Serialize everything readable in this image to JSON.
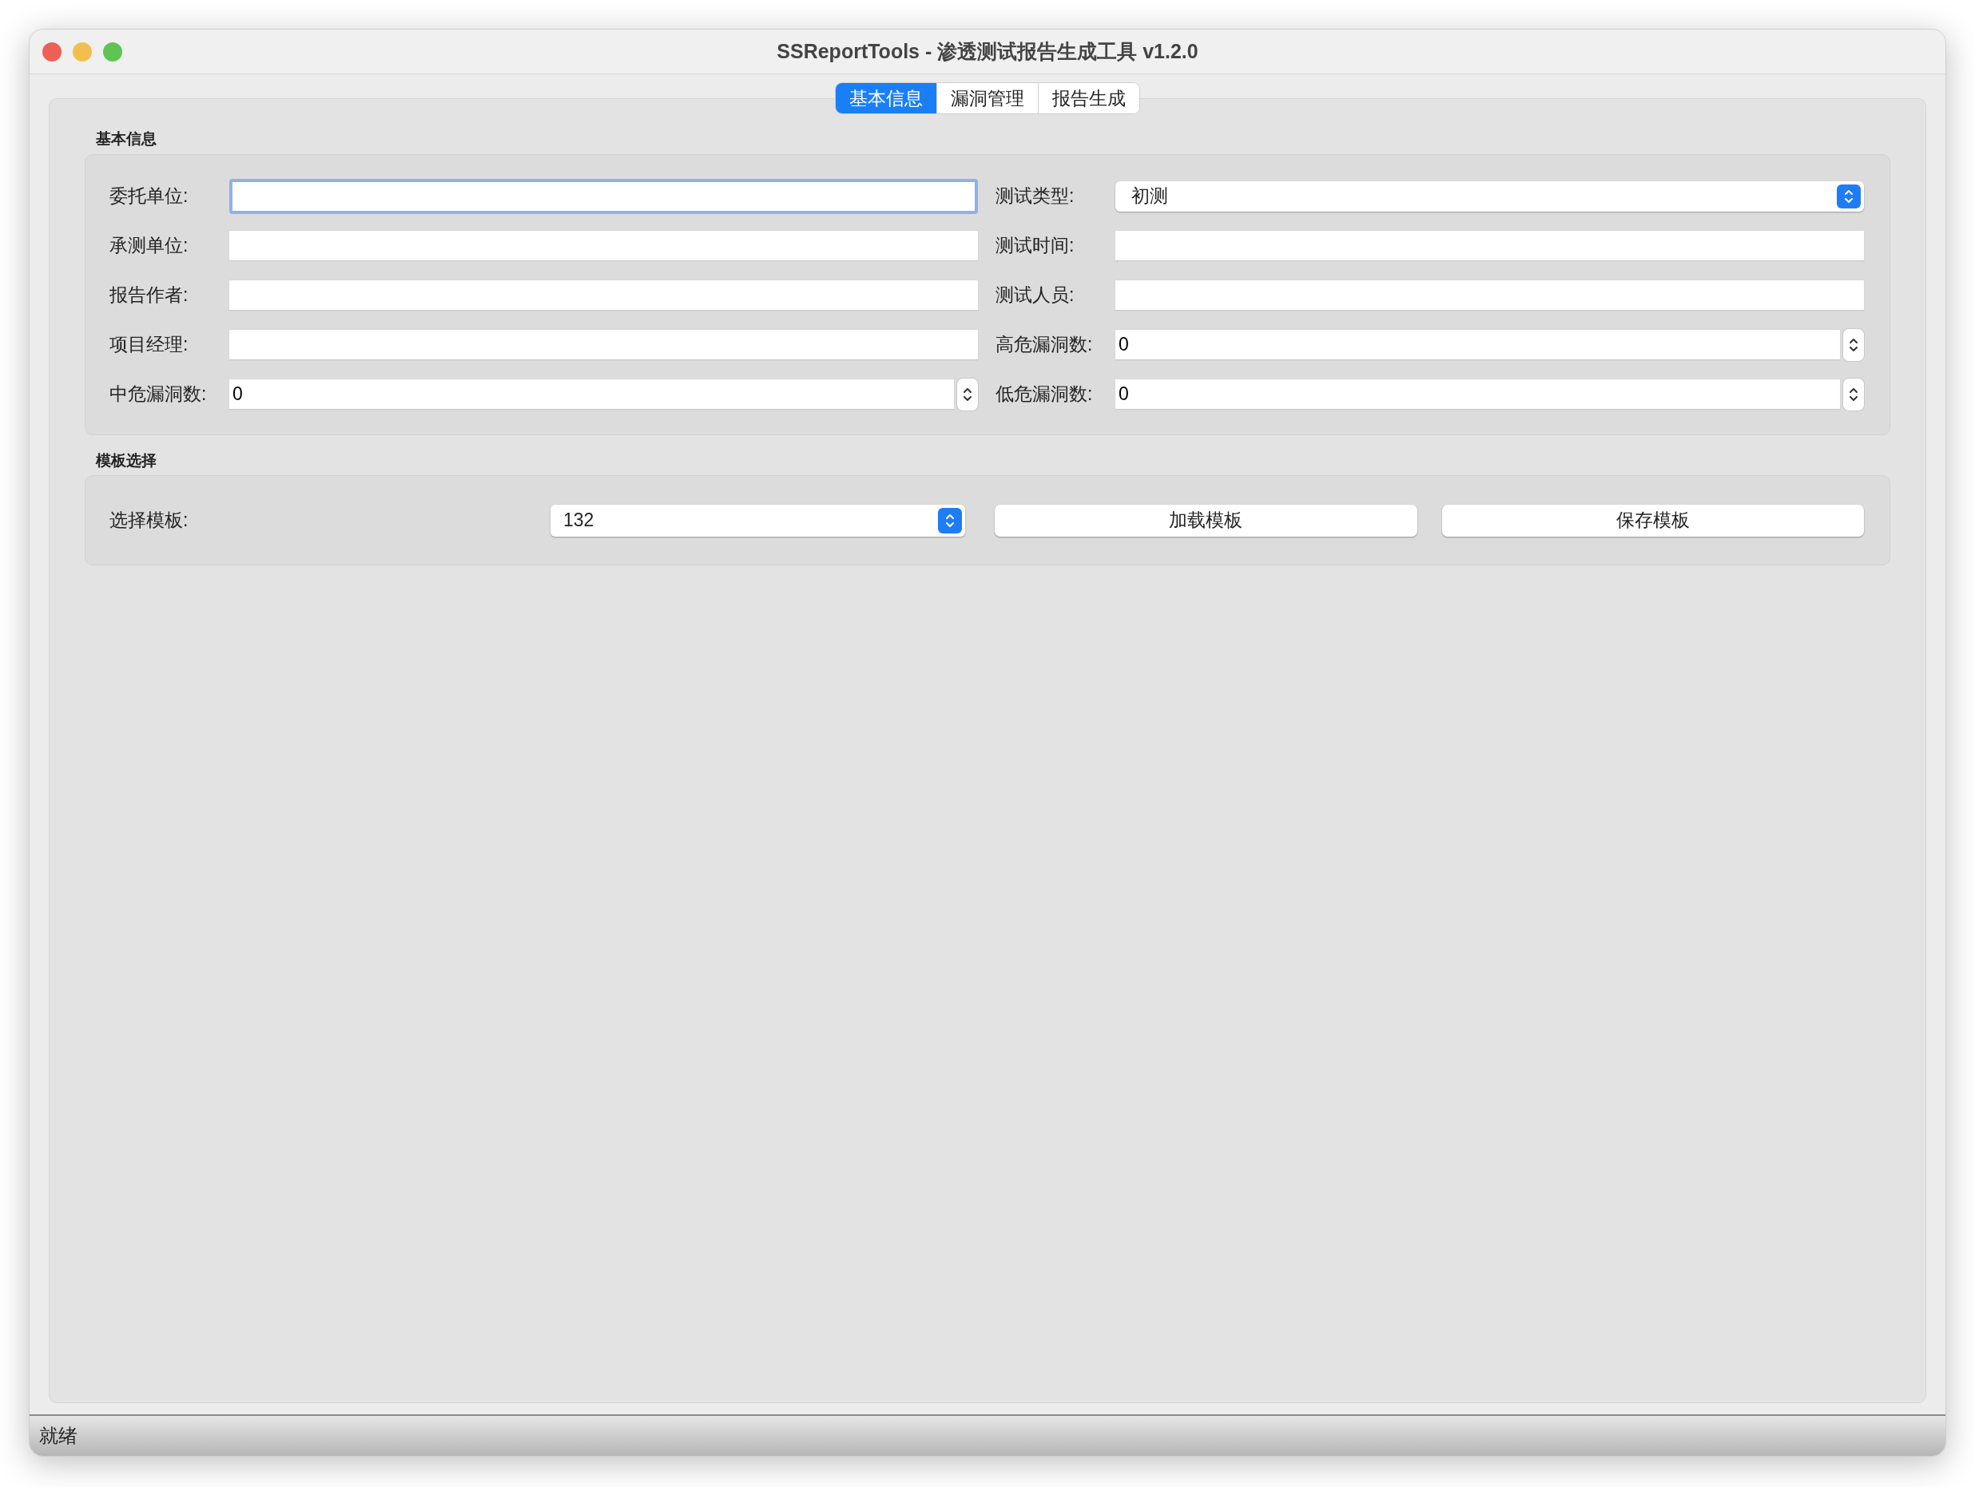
{
  "window": {
    "title": "SSReportTools - 渗透测试报告生成工具 v1.2.0"
  },
  "tabs": [
    {
      "label": "基本信息",
      "selected": true
    },
    {
      "label": "漏洞管理",
      "selected": false
    },
    {
      "label": "报告生成",
      "selected": false
    }
  ],
  "basic_info": {
    "title": "基本信息",
    "fields": [
      {
        "label": "委托单位:",
        "kind": "text",
        "focused": true
      },
      {
        "label": "测试类型:",
        "kind": "combo",
        "value": "初测",
        "focused": false
      },
      {
        "label": "承测单位:",
        "kind": "text",
        "focused": false
      },
      {
        "label": "测试时间:",
        "kind": "text",
        "focused": false
      },
      {
        "label": "报告作者:",
        "kind": "text",
        "focused": false
      },
      {
        "label": "测试人员:",
        "kind": "text",
        "focused": false
      },
      {
        "label": "项目经理:",
        "kind": "text",
        "focused": false
      },
      {
        "label": "高危漏洞数:",
        "kind": "spin",
        "value": "0",
        "focused": false
      },
      {
        "label": "中危漏洞数:",
        "kind": "spin",
        "value": "0",
        "focused": false
      },
      {
        "label": "低危漏洞数:",
        "kind": "spin",
        "value": "0",
        "focused": false
      }
    ]
  },
  "template": {
    "title": "模板选择",
    "label": "选择模板:",
    "value": "132",
    "buttons": [
      "加载模板",
      "保存模板"
    ]
  },
  "status_bar": "就绪"
}
